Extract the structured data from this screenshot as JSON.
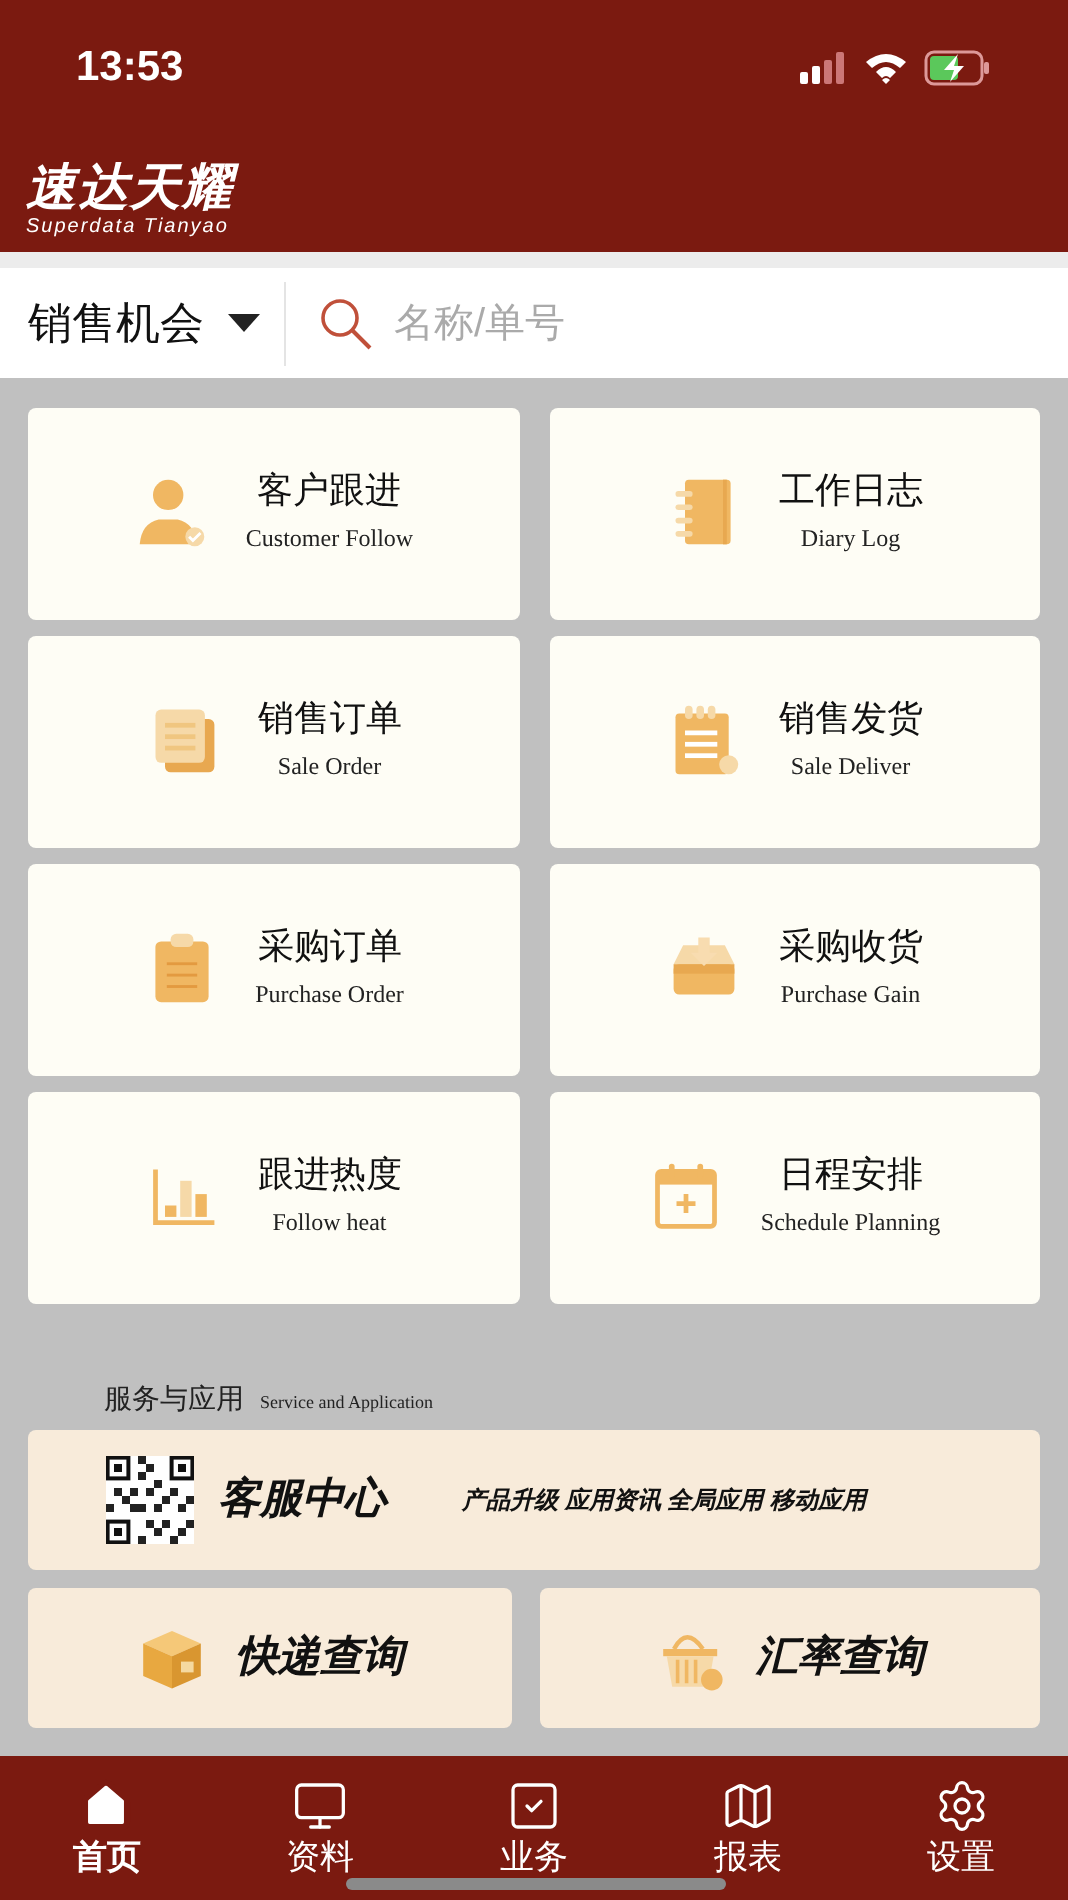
{
  "status_bar": {
    "time": "13:53"
  },
  "header": {
    "logo_title": "速达天耀",
    "logo_subtitle": "Superdata Tianyao"
  },
  "filter": {
    "label": "销售机会"
  },
  "search": {
    "placeholder": "名称/单号"
  },
  "modules": [
    {
      "title": "客户跟进",
      "subtitle": "Customer Follow"
    },
    {
      "title": "工作日志",
      "subtitle": "Diary Log"
    },
    {
      "title": "销售订单",
      "subtitle": "Sale Order"
    },
    {
      "title": "销售发货",
      "subtitle": "Sale Deliver"
    },
    {
      "title": "采购订单",
      "subtitle": "Purchase Order"
    },
    {
      "title": "采购收货",
      "subtitle": "Purchase Gain"
    },
    {
      "title": "跟进热度",
      "subtitle": "Follow heat"
    },
    {
      "title": "日程安排",
      "subtitle": "Schedule Planning"
    }
  ],
  "services": {
    "title": "服务与应用",
    "subtitle": "Service and Application",
    "center": {
      "title": "客服中心",
      "tagline": "产品升级 应用资讯 全局应用 移动应用"
    },
    "tools": [
      {
        "title": "快递查询"
      },
      {
        "title": "汇率查询"
      }
    ]
  },
  "tab_bar": [
    {
      "label": "首页",
      "selected": true
    },
    {
      "label": "资料",
      "selected": false
    },
    {
      "label": "业务",
      "selected": false
    },
    {
      "label": "报表",
      "selected": false
    },
    {
      "label": "设置",
      "selected": false
    }
  ]
}
